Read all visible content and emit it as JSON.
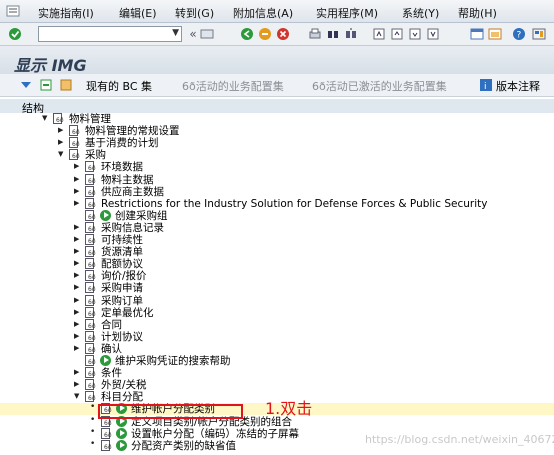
{
  "menubar": {
    "items": [
      "实施指南(I)",
      "编辑(E)",
      "转到(G)",
      "附加信息(A)",
      "实用程序(M)",
      "系统(Y)",
      "帮助(H)"
    ]
  },
  "toolbar": {
    "command_value": "",
    "history_symbol": "«"
  },
  "title": "显示 IMG",
  "app_toolbar": {
    "bc_sets": "现有的 BC 集",
    "active_bc": "6ð活动的业务配置集",
    "activated_bc": "6ð活动已激活的业务配置集",
    "release_notes": "版本注释"
  },
  "tree_header": "结构",
  "tree": [
    {
      "label": "物料管理",
      "level": 0,
      "expand": "open",
      "exec": false
    },
    {
      "label": "物料管理的常规设置",
      "level": 1,
      "expand": "closed",
      "exec": false
    },
    {
      "label": "基于消费的计划",
      "level": 1,
      "expand": "closed",
      "exec": false
    },
    {
      "label": "采购",
      "level": 1,
      "expand": "open",
      "exec": false
    },
    {
      "label": "环境数据",
      "level": 2,
      "expand": "closed",
      "exec": false
    },
    {
      "label": "物料主数据",
      "level": 2,
      "expand": "closed",
      "exec": false
    },
    {
      "label": "供应商主数据",
      "level": 2,
      "expand": "closed",
      "exec": false
    },
    {
      "label": "Restrictions for the Industry Solution for Defense Forces & Public Security",
      "level": 2,
      "expand": "closed",
      "exec": false
    },
    {
      "label": "创建采购组",
      "level": 2,
      "expand": "none",
      "exec": true
    },
    {
      "label": "采购信息记录",
      "level": 2,
      "expand": "closed",
      "exec": false
    },
    {
      "label": "可持续性",
      "level": 2,
      "expand": "closed",
      "exec": false
    },
    {
      "label": "货源清单",
      "level": 2,
      "expand": "closed",
      "exec": false
    },
    {
      "label": "配额协议",
      "level": 2,
      "expand": "closed",
      "exec": false
    },
    {
      "label": "询价/报价",
      "level": 2,
      "expand": "closed",
      "exec": false
    },
    {
      "label": "采购申请",
      "level": 2,
      "expand": "closed",
      "exec": false
    },
    {
      "label": "采购订单",
      "level": 2,
      "expand": "closed",
      "exec": false
    },
    {
      "label": "定单最优化",
      "level": 2,
      "expand": "closed",
      "exec": false
    },
    {
      "label": "合同",
      "level": 2,
      "expand": "closed",
      "exec": false
    },
    {
      "label": "计划协议",
      "level": 2,
      "expand": "closed",
      "exec": false
    },
    {
      "label": "确认",
      "level": 2,
      "expand": "closed",
      "exec": false
    },
    {
      "label": "维护采购凭证的搜索帮助",
      "level": 2,
      "expand": "none",
      "exec": true
    },
    {
      "label": "条件",
      "level": 2,
      "expand": "closed",
      "exec": false
    },
    {
      "label": "外贸/关税",
      "level": 2,
      "expand": "closed",
      "exec": false
    },
    {
      "label": "科目分配",
      "level": 2,
      "expand": "open",
      "exec": false
    },
    {
      "label": "维护帐户分配类别",
      "level": 3,
      "expand": "bullet",
      "exec": true,
      "highlight": true
    },
    {
      "label": "定义项目类别/帐户分配类别的组合",
      "level": 3,
      "expand": "bullet",
      "exec": true
    },
    {
      "label": "设置帐户分配（编码）冻结的子屏幕",
      "level": 3,
      "expand": "bullet",
      "exec": true
    },
    {
      "label": "分配资产类别的缺省值",
      "level": 3,
      "expand": "bullet",
      "exec": true
    }
  ],
  "annotation": "1.双击",
  "watermark": "https://blog.csdn.net/weixin_40672823",
  "colors": {
    "highlight_bg": "#fff8c6",
    "annotation_red": "#e0141a",
    "exec_green": "#2c9a3a"
  }
}
